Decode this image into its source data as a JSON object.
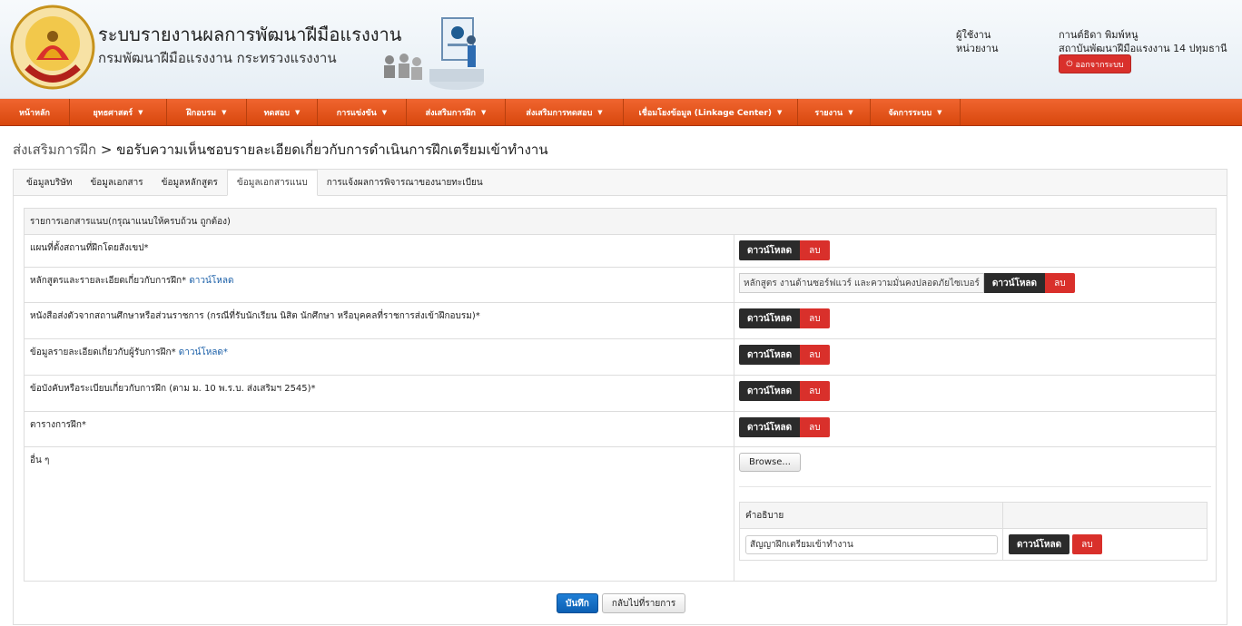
{
  "header": {
    "title": "ระบบรายงานผลการพัฒนาฝีมือแรงงาน",
    "subtitle": "กรมพัฒนาฝีมือแรงงาน กระทรวงแรงงาน",
    "user_label": "ผู้ใช้งาน",
    "user_value": "กานต์ธิดา พิมพ์หนู",
    "unit_label": "หน่วยงาน",
    "unit_value": "สถาบันพัฒนาฝีมือแรงงาน 14 ปทุมธานี",
    "logout_label": "ออกจากระบบ"
  },
  "nav": [
    {
      "label": "หน้าหลัก",
      "dropdown": false
    },
    {
      "label": "ยุทธศาสตร์",
      "dropdown": true
    },
    {
      "label": "ฝึกอบรม",
      "dropdown": true
    },
    {
      "label": "ทดสอบ",
      "dropdown": true
    },
    {
      "label": "การแข่งขัน",
      "dropdown": true
    },
    {
      "label": "ส่งเสริมการฝึก",
      "dropdown": true
    },
    {
      "label": "ส่งเสริมการทดสอบ",
      "dropdown": true
    },
    {
      "label": "เชื่อมโยงข้อมูล (Linkage Center)",
      "dropdown": true
    },
    {
      "label": "รายงาน",
      "dropdown": true
    },
    {
      "label": "จัดการระบบ",
      "dropdown": true
    }
  ],
  "breadcrumb": {
    "parent": "ส่งเสริมการฝึก",
    "separator": ">",
    "current": "ขอรับความเห็นชอบรายละเอียดเกี่ยวกับการดำเนินการฝึกเตรียมเข้าทำงาน"
  },
  "tabs": [
    {
      "label": "ข้อมูลบริษัท",
      "active": false
    },
    {
      "label": "ข้อมูลเอกสาร",
      "active": false
    },
    {
      "label": "ข้อมูลหลักสูตร",
      "active": false
    },
    {
      "label": "ข้อมูลเอกสารแนบ",
      "active": true
    },
    {
      "label": "การแจ้งผลการพิจารณาของนายทะเบียน",
      "active": false
    }
  ],
  "attachments": {
    "header": "รายการเอกสารแนบ(กรุณาแนบให้ครบถ้วน ถูกต้อง)",
    "rows": [
      {
        "label": "แผนที่ตั้งสถานที่ฝึกโดยสังเขป*",
        "link": ""
      },
      {
        "label": "หลักสูตรและรายละเอียดเกี่ยวกับการฝึก*",
        "link": "ดาวน์โหลด",
        "file": "หลักสูตร งานด้านซอร์ฟแวร์ และความมั่นคงปลอดภัยไซเบอร์"
      },
      {
        "label": "หนังสือส่งตัวจากสถานศึกษาหรือส่วนราชการ (กรณีที่รับนักเรียน นิสิต นักศึกษา หรือบุคคลที่ราชการส่งเข้าฝึกอบรม)*",
        "link": ""
      },
      {
        "label": "ข้อมูลรายละเอียดเกี่ยวกับผู้รับการฝึก*",
        "link": "ดาวน์โหลด*"
      },
      {
        "label": "ข้อบังคับหรือระเบียบเกี่ยวกับการฝึก (ตาม ม. 10 พ.ร.บ. ส่งเสริมฯ 2545)*",
        "link": ""
      },
      {
        "label": "ตารางการฝึก*",
        "link": ""
      }
    ],
    "other_label": "อื่น ๆ",
    "browse_label": "Browse...",
    "desc_header": "คำอธิบาย",
    "desc_value": "สัญญาฝึกเตรียมเข้าทำงาน",
    "download_label": "ดาวน์โหลด",
    "delete_label": "ลบ"
  },
  "footer": {
    "save_label": "บันทึก",
    "back_label": "กลับไปที่รายการ"
  },
  "colors": {
    "nav": "#e0521a",
    "delete": "#d9302b",
    "download": "#2b2b2b",
    "save": "#1570c8",
    "link": "#1a5fa8"
  }
}
